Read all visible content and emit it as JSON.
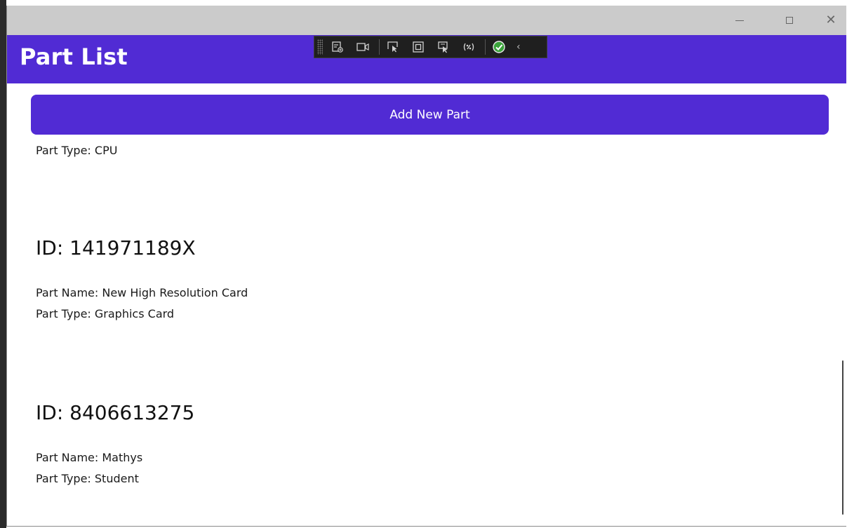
{
  "window": {
    "controls": {
      "minimize_icon": "minimize-icon",
      "maximize_icon": "maximize-icon",
      "close_icon": "close-icon",
      "close_glyph": "✕"
    }
  },
  "header": {
    "title": "Part List",
    "background_color": "#512bd4"
  },
  "debug_toolbar": {
    "icons": [
      "live-visual-tree-icon",
      "record-icon",
      "select-element-icon",
      "display-layout-adorners-icon",
      "track-focused-element-icon",
      "hot-reload-icon",
      "binding-failures-ok-icon"
    ],
    "collapse_glyph": "‹"
  },
  "main": {
    "add_button_label": "Add New Part",
    "partial_first_item": {
      "part_type": "Part Type: CPU"
    },
    "parts": [
      {
        "id": "ID: 141971189X",
        "name": "Part Name: New High Resolution  Card",
        "type": "Part Type: Graphics Card"
      },
      {
        "id": "ID: 8406613275",
        "name": "Part Name: Mathys",
        "type": "Part Type: Student"
      }
    ]
  }
}
